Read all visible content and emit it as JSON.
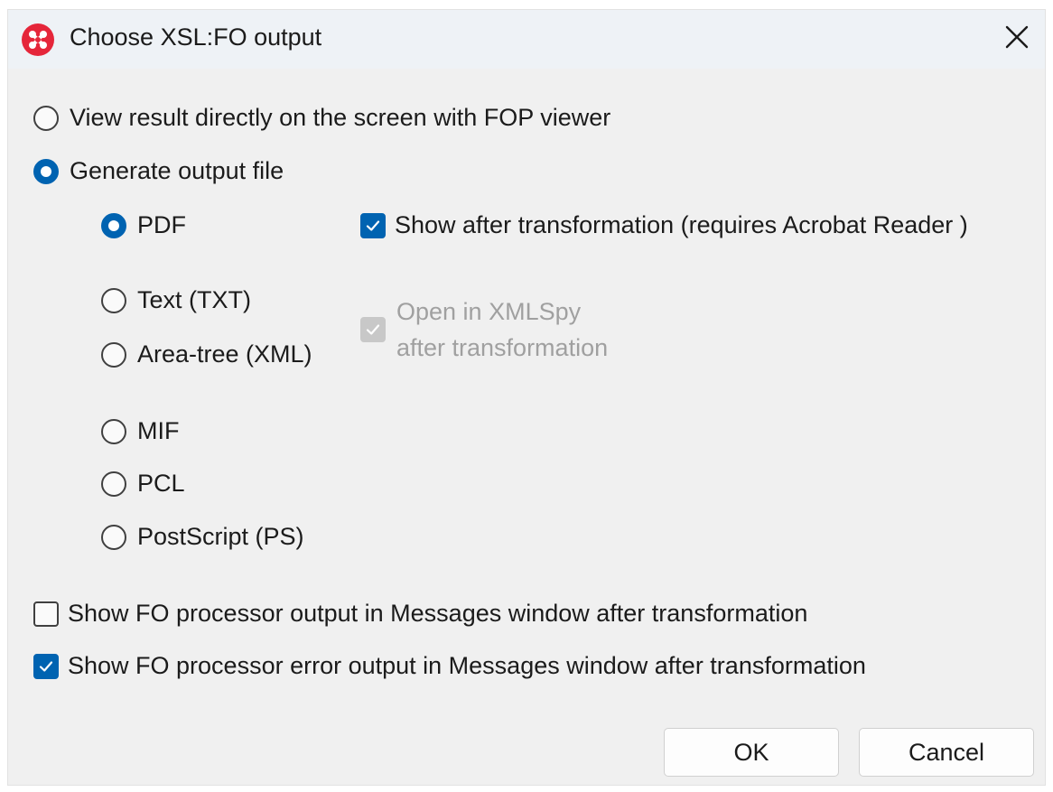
{
  "window": {
    "title": "Choose XSL:FO output",
    "app_icon": "altova-logo-icon",
    "close_icon": "close-icon",
    "accent_color": "#0063b1"
  },
  "mode": {
    "view_on_screen_label": "View result directly on the screen with FOP viewer",
    "view_on_screen_selected": false,
    "generate_file_label": "Generate output file",
    "generate_file_selected": true
  },
  "formats": [
    {
      "label": "PDF",
      "selected": true
    },
    {
      "label": "Text (TXT)",
      "selected": false
    },
    {
      "label": "Area-tree (XML)",
      "selected": false
    },
    {
      "label": "MIF",
      "selected": false
    },
    {
      "label": "PCL",
      "selected": false
    },
    {
      "label": "PostScript (PS)",
      "selected": false
    }
  ],
  "pdf_options": {
    "show_after_label": "Show after transformation (requires Acrobat Reader )",
    "show_after_checked": true
  },
  "xml_options": {
    "open_in_xmlspy_line1": "Open in XMLSpy",
    "open_in_xmlspy_line2": "after transformation",
    "open_in_xmlspy_checked": true,
    "open_in_xmlspy_disabled": true
  },
  "messages": {
    "show_output_label": "Show FO processor output in Messages window after transformation",
    "show_output_checked": false,
    "show_error_label": "Show FO processor error output in Messages window after transformation",
    "show_error_checked": true
  },
  "buttons": {
    "ok": "OK",
    "cancel": "Cancel"
  }
}
